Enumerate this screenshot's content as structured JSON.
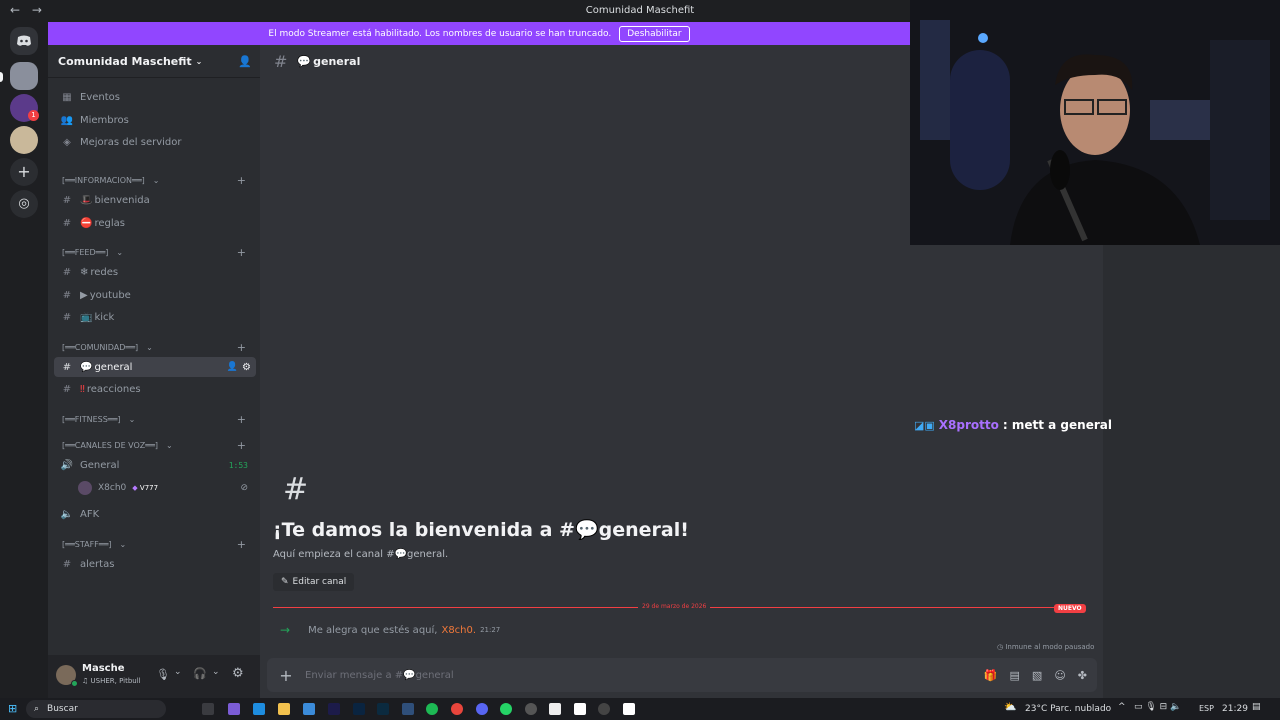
{
  "window": {
    "title": "Comunidad Maschefit"
  },
  "streamer_banner": {
    "text": "El modo Streamer está habilitado. Los nombres de usuario se han truncado.",
    "button": "Deshabilitar"
  },
  "server": {
    "name": "Comunidad Maschefit"
  },
  "sidebar": {
    "top_items": [
      {
        "label": "Eventos",
        "icon": "calendar-icon"
      },
      {
        "label": "Miembros",
        "icon": "members-icon"
      },
      {
        "label": "Mejoras del servidor",
        "icon": "boost-icon"
      }
    ],
    "categories": {
      "informacion": "[══INFORMACION══]",
      "feed": "[══FEED══]",
      "comunidad": "[══COMUNIDAD══]",
      "fitness": "[══FITNESS══]",
      "voz": "[══CANALES DE VOZ══]",
      "staff": "[══STAFF══]"
    },
    "channels": {
      "bienvenida": "bienvenida",
      "reglas": "reglas",
      "redes": "redes",
      "youtube": "youtube",
      "kick": "kick",
      "general": "general",
      "reacciones": "reacciones",
      "voice_general": "General",
      "voice_time": "1:53",
      "voice_user": "X8ch0",
      "voice_badge": "V777",
      "afk": "AFK",
      "alertas": "alertas"
    }
  },
  "channel_header": {
    "name": "general"
  },
  "overlay_chat": {
    "user": "X8protto",
    "text": ": mett a general"
  },
  "welcome": {
    "title": "¡Te damos la bienvenida a #💬general!",
    "subtitle": "Aquí empieza el canal #💬general.",
    "edit_button": "Editar canal"
  },
  "divider": {
    "date": "29 de marzo de 2026",
    "badge": "NUEVO"
  },
  "message": {
    "text": "Me alegra que estés aquí,",
    "name": "X8ch0.",
    "time": "21:27"
  },
  "immune_text": "Inmune al modo pausado",
  "composer": {
    "placeholder": "Enviar mensaje a #💬general"
  },
  "user_panel": {
    "name": "Masche",
    "status": "USHER, Pitbull"
  },
  "taskbar": {
    "search": "Buscar",
    "weather": "23°C  Parc. nublado",
    "lang": "ESP",
    "time": "21:29"
  }
}
